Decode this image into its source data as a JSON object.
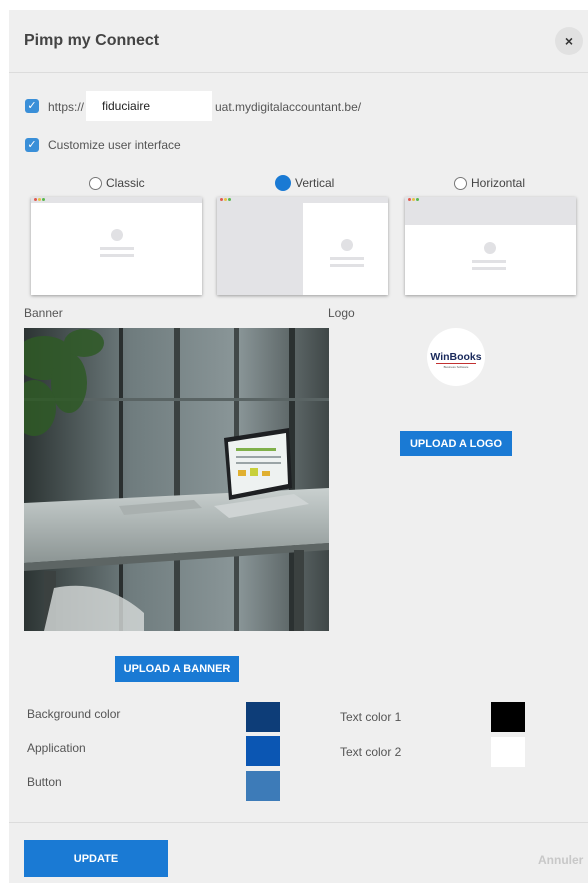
{
  "dialog": {
    "title": "Pimp my Connect",
    "close_label": "×"
  },
  "url": {
    "prefix": "https://",
    "value": "fiduciaire",
    "suffix": "uat.mydigitalaccountant.be/"
  },
  "customize": {
    "label": "Customize user interface"
  },
  "layouts": {
    "options": [
      {
        "label": "Classic",
        "selected": false
      },
      {
        "label": "Vertical",
        "selected": true
      },
      {
        "label": "Horizontal",
        "selected": false
      }
    ]
  },
  "banner": {
    "label": "Banner",
    "upload_label": "UPLOAD A BANNER"
  },
  "logo": {
    "label": "Logo",
    "upload_label": "UPLOAD A LOGO",
    "logo_text": "WinBooks",
    "logo_tagline": "Business Software"
  },
  "colors": {
    "background_color": {
      "label": "Background color",
      "value": "#0d3d78"
    },
    "application": {
      "label": "Application",
      "value": "#0b56b3"
    },
    "button": {
      "label": "Button",
      "value": "#3d7bb8"
    },
    "text_color_1": {
      "label": "Text color 1",
      "value": "#000000"
    },
    "text_color_2": {
      "label": "Text color 2",
      "value": "#ffffff"
    }
  },
  "footer": {
    "update_label": "UPDATE",
    "cancel_label": "Annuler"
  },
  "accent_color": "#1a7ad4"
}
